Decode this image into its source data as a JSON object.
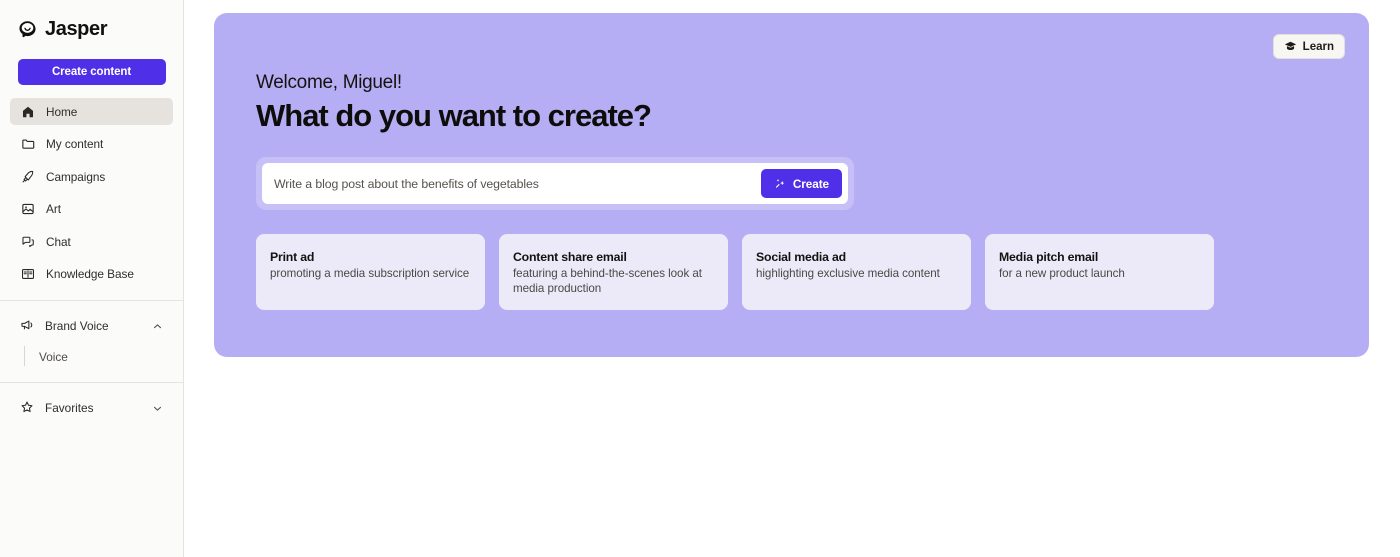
{
  "brand": {
    "name": "Jasper",
    "logo_icon": "jasper-face-logo"
  },
  "sidebar": {
    "create_button": "Create content",
    "items": [
      {
        "label": "Home",
        "icon": "home-icon",
        "active": true
      },
      {
        "label": "My content",
        "icon": "folder-icon",
        "active": false
      },
      {
        "label": "Campaigns",
        "icon": "rocket-icon",
        "active": false
      },
      {
        "label": "Art",
        "icon": "image-icon",
        "active": false
      },
      {
        "label": "Chat",
        "icon": "chat-bubbles-icon",
        "active": false
      },
      {
        "label": "Knowledge Base",
        "icon": "open-book-icon",
        "active": false
      }
    ],
    "brand_voice": {
      "label": "Brand Voice",
      "icon": "megaphone-icon",
      "chevron": "chevron-up-icon",
      "expanded": true,
      "children": [
        {
          "label": "Voice"
        }
      ]
    },
    "favorites": {
      "label": "Favorites",
      "icon": "star-icon",
      "chevron": "chevron-down-icon",
      "expanded": false
    }
  },
  "hero": {
    "learn_button": {
      "label": "Learn",
      "icon": "graduation-cap-icon"
    },
    "welcome": "Welcome, Miguel!",
    "headline": "What do you want to create?",
    "prompt": {
      "value": "Write a blog post about the benefits of vegetables",
      "placeholder": "Write a blog post about the benefits of vegetables",
      "create_label": "Create",
      "create_icon": "sparkle-icon"
    },
    "cards": [
      {
        "title": "Print ad",
        "subtitle": "promoting a media subscription service"
      },
      {
        "title": "Content share email",
        "subtitle": "featuring a behind-the-scenes look at media production"
      },
      {
        "title": "Social media ad",
        "subtitle": "highlighting exclusive media content"
      },
      {
        "title": "Media pitch email",
        "subtitle": "for a new product launch"
      }
    ]
  },
  "colors": {
    "brand_purple": "#4f2fe8",
    "hero_panel": "#b6aef4",
    "card_bg": "#eceaf9",
    "sidebar_bg": "#fbfbfa",
    "active_nav": "#e6e3de"
  }
}
